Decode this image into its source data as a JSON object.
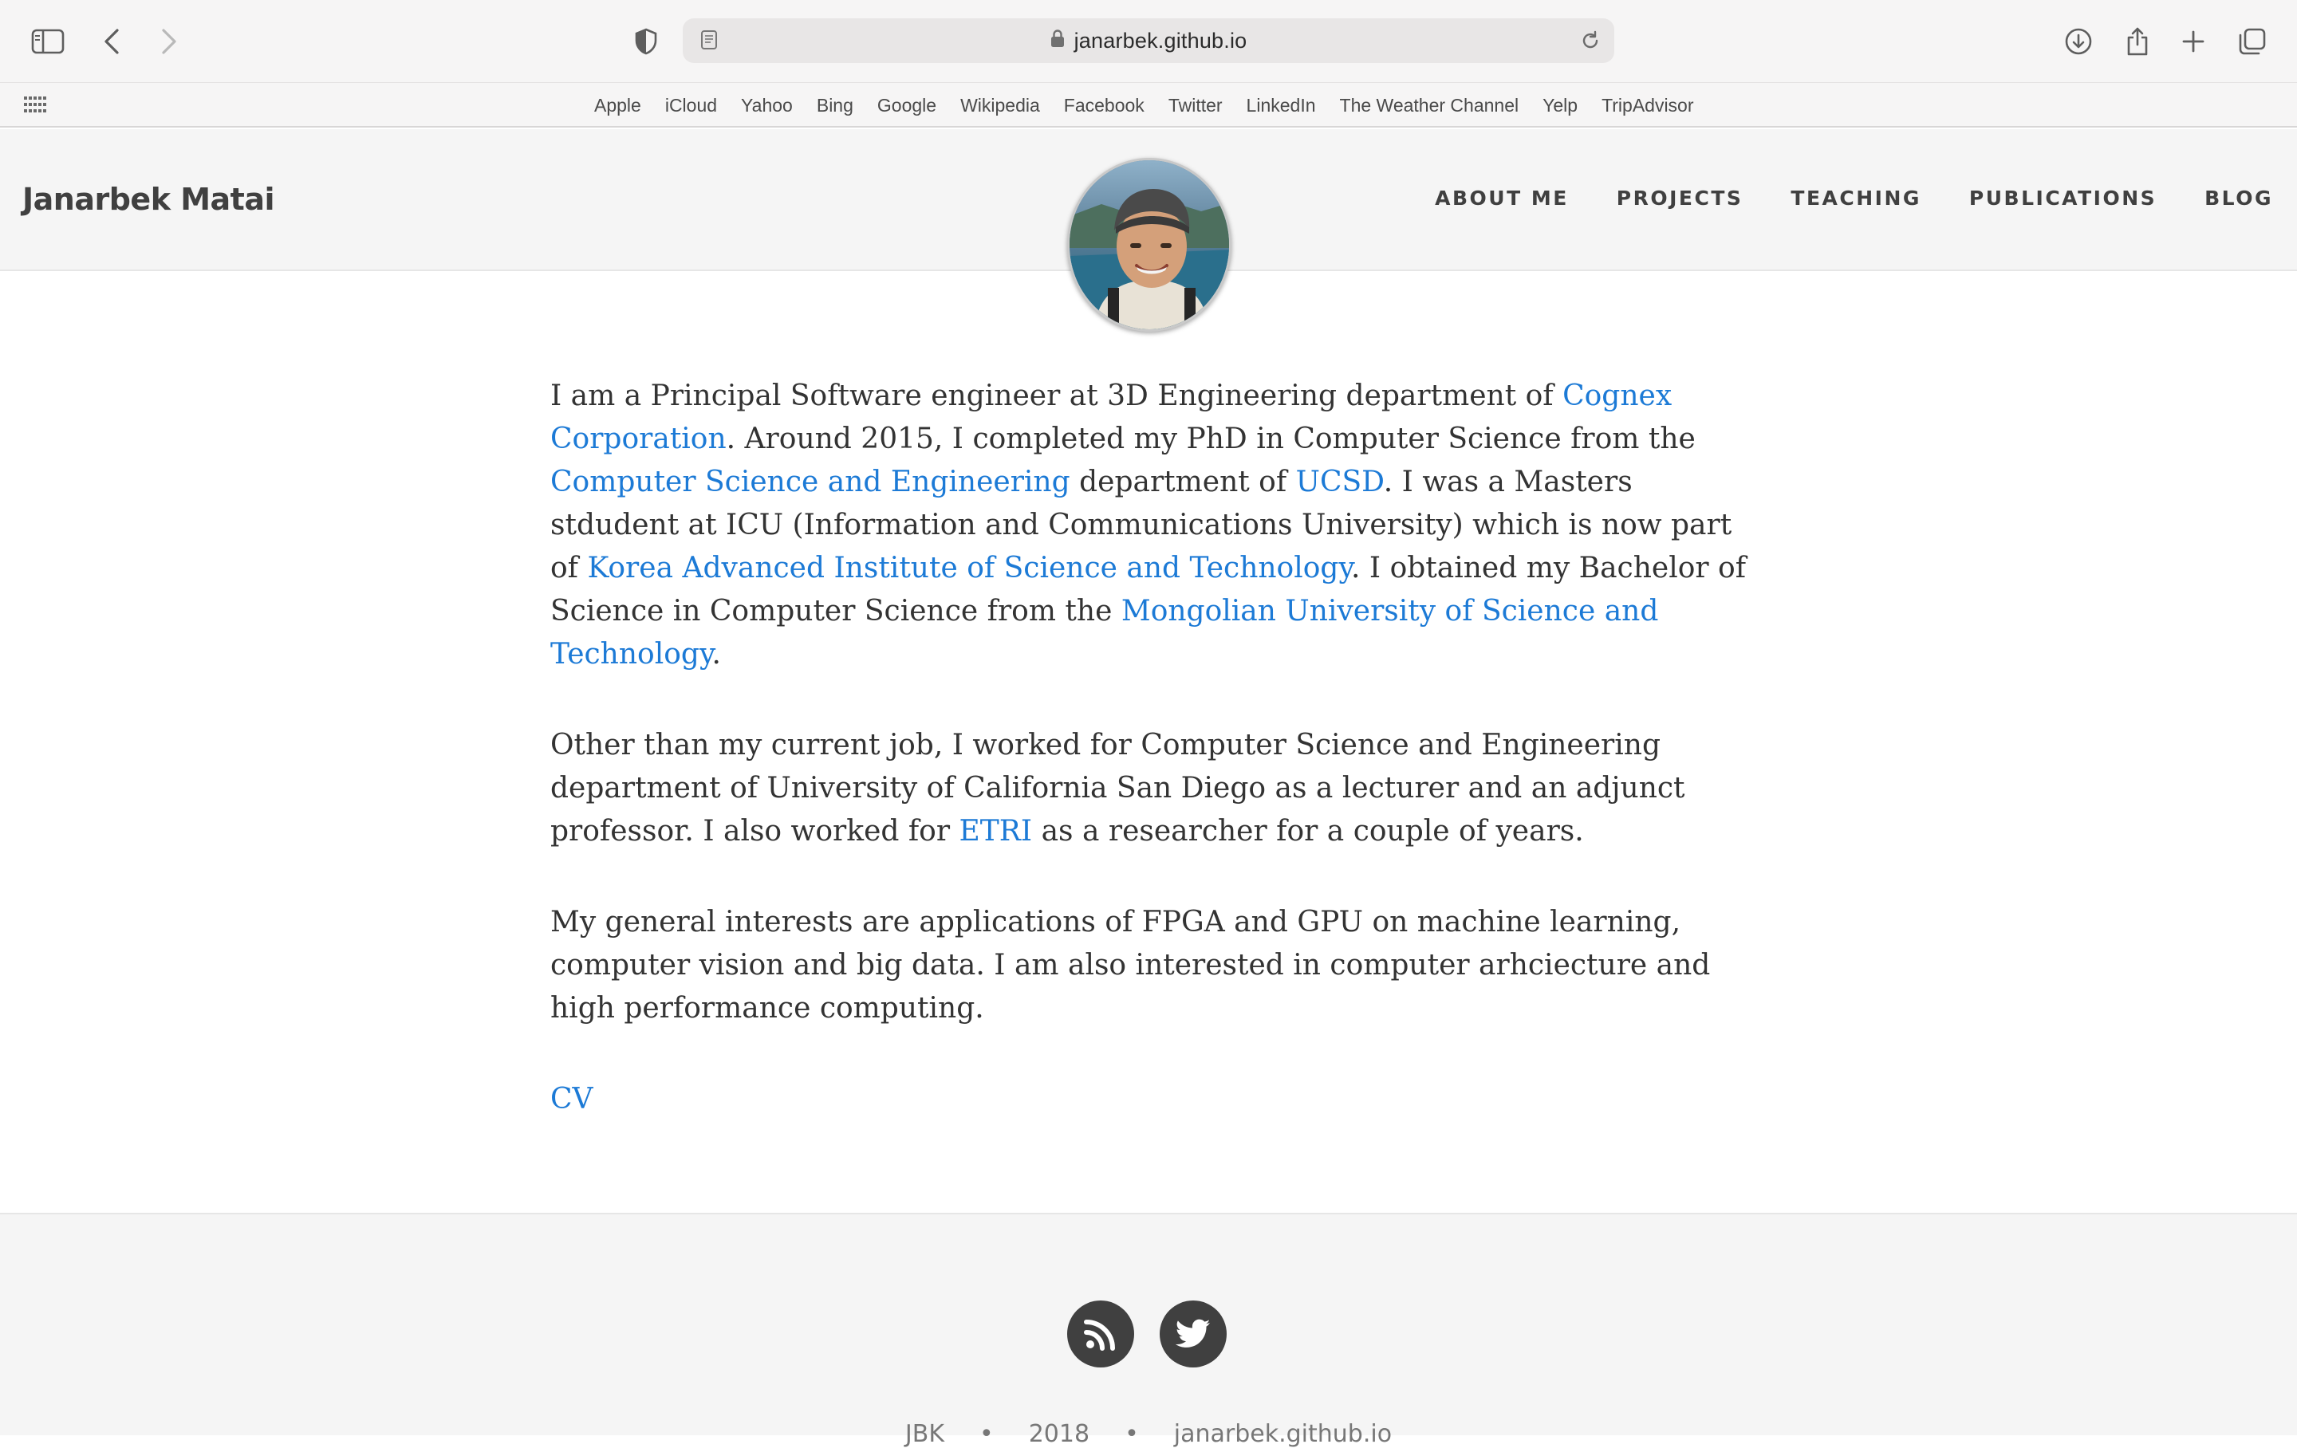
{
  "browser": {
    "url": "janarbek.github.io",
    "favorites": [
      "Apple",
      "iCloud",
      "Yahoo",
      "Bing",
      "Google",
      "Wikipedia",
      "Facebook",
      "Twitter",
      "LinkedIn",
      "The Weather Channel",
      "Yelp",
      "TripAdvisor"
    ]
  },
  "site": {
    "brand": "Janarbek Matai",
    "nav": [
      "ABOUT ME",
      "PROJECTS",
      "TEACHING",
      "PUBLICATIONS",
      "BLOG"
    ]
  },
  "content": {
    "p1": {
      "t1": "I am a Principal Software engineer at 3D Engineering department of ",
      "l1": "Cognex Corporation",
      "t2": ". Around 2015, I completed my PhD in Computer Science from the ",
      "l2": "Computer Science and Engineering",
      "t3": " department of ",
      "l3": "UCSD",
      "t4": ". I was a Masters stdudent at ICU (Information and Communications University) which is now part of ",
      "l4": "Korea Advanced Institute of Science and Technology",
      "t5": ". I obtained my Bachelor of Science in Computer Science from the ",
      "l5": "Mongolian University of Science and Technology",
      "t6": "."
    },
    "p2": {
      "t1": "Other than my current job, I worked for Computer Science and Engineering department of University of California San Diego as a lecturer and an adjunct professor. I also worked for ",
      "l1": "ETRI",
      "t2": " as a researcher for a couple of years."
    },
    "p3": "My general interests are applications of FPGA and GPU on machine learning, computer vision and big data. I am also interested in computer arhciecture and high performance computing.",
    "cv_link": "CV"
  },
  "footer": {
    "social": [
      "rss-icon",
      "twitter-icon"
    ],
    "copyright": [
      "JBK",
      "•",
      "2018",
      "•",
      "janarbek.github.io"
    ]
  },
  "colors": {
    "link": "#1c7ad6",
    "header_bg": "#f5f5f5",
    "text": "#333333",
    "icon_circle": "#404040"
  }
}
